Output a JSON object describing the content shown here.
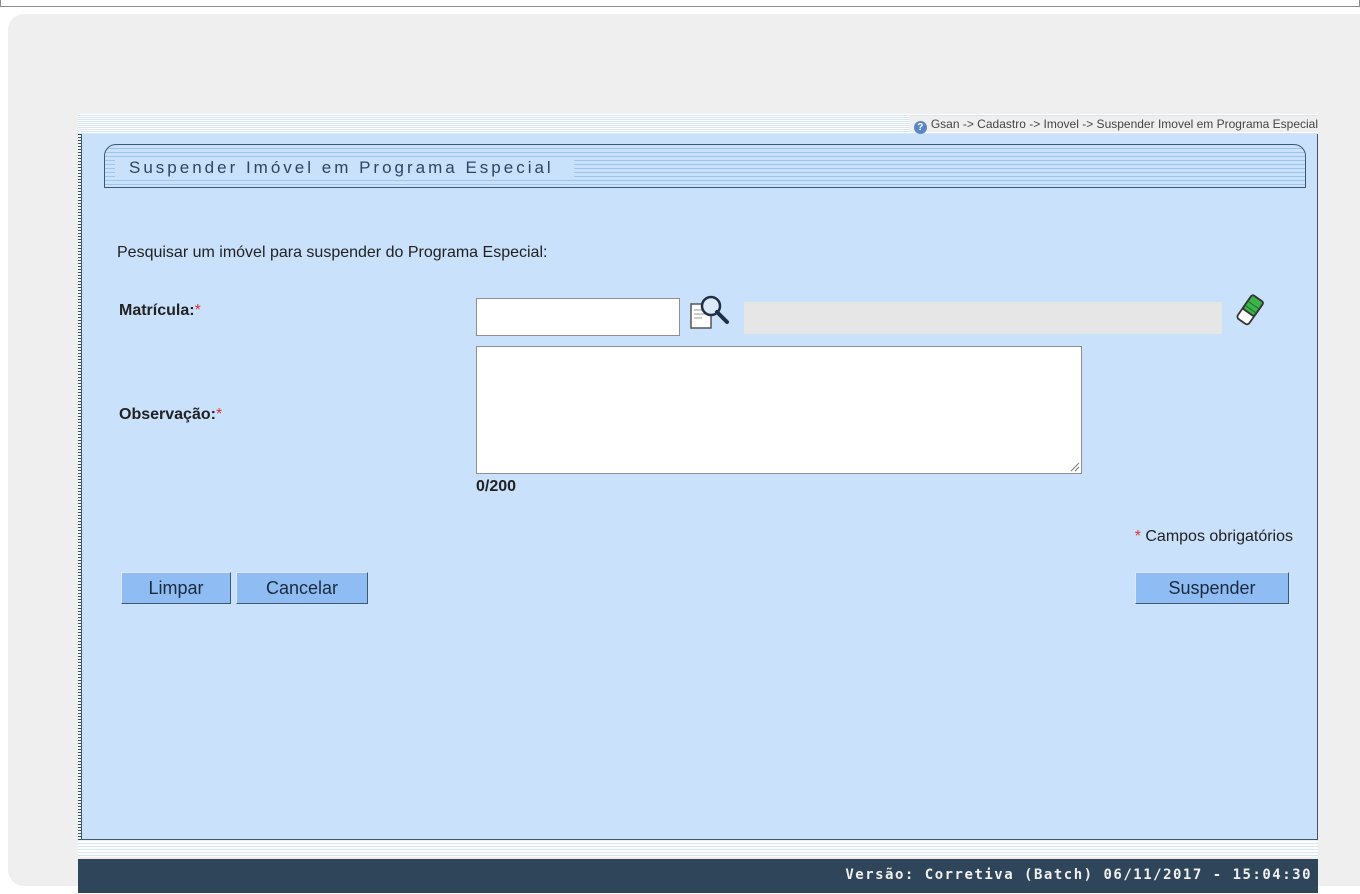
{
  "breadcrumb": {
    "help_icon": "question-circle-icon",
    "path": "Gsan -> Cadastro -> Imovel -> Suspender Imovel em Programa Especial"
  },
  "page": {
    "title": "Suspender Imóvel em Programa Especial",
    "intro": "Pesquisar um imóvel para suspender do Programa Especial:"
  },
  "form": {
    "matricula": {
      "label": "Matrícula:",
      "required_mark": "*",
      "value": "",
      "description_value": "",
      "search_icon": "magnifier-search-icon",
      "clear_icon": "eraser-icon"
    },
    "observacao": {
      "label": "Observação:",
      "required_mark": "*",
      "value": "",
      "counter": "0/200"
    },
    "required_note": {
      "mark": "*",
      "text": "Campos obrigatórios"
    }
  },
  "buttons": {
    "limpar": "Limpar",
    "cancelar": "Cancelar",
    "suspender": "Suspender"
  },
  "footer": {
    "version": "Versão: Corretiva (Batch) 06/11/2017 - 15:04:30"
  },
  "colors": {
    "panel_background": "#c9e1fb",
    "button_background": "#8fbdf3",
    "footer_background": "#2f4559",
    "required_mark": "#e0342e"
  }
}
